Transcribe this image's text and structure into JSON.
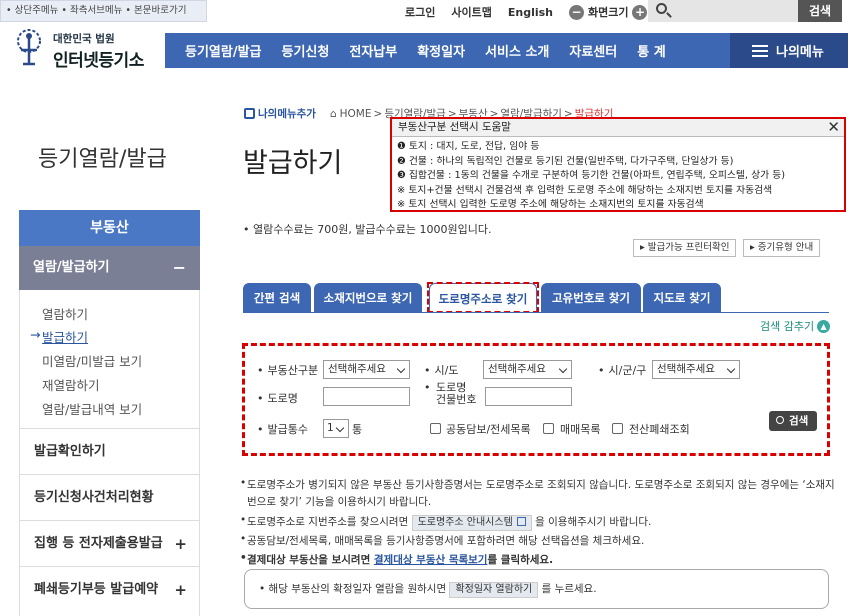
{
  "skip_links": "• 상단주메뉴  • 좌측서브메뉴  • 본문바로가기",
  "util": {
    "login": "로그인",
    "sitemap": "사이트맵",
    "english": "English",
    "screen_size": "화면크기",
    "minus": "−",
    "plus": "+"
  },
  "search": {
    "button": "검색",
    "placeholder": ""
  },
  "logo": {
    "small": "대한민국 법원",
    "big": "인터넷등기소"
  },
  "gnb": [
    "등기열람/발급",
    "등기신청",
    "전자납부",
    "확정일자",
    "서비스 소개",
    "자료센터",
    "통 계"
  ],
  "my_menu": "나의메뉴",
  "sidebar": {
    "title": "등기열람/발급",
    "head": "부동산",
    "active": "열람/발급하기",
    "active_toggle": "−",
    "sub_items": [
      "열람하기",
      "발급하기",
      "미열람/미발급 보기",
      "재열람하기",
      "열람/발급내역 보기"
    ],
    "arrow": "→",
    "items": [
      {
        "label": "발급확인하기",
        "toggle": ""
      },
      {
        "label": "등기신청사건처리현황",
        "toggle": ""
      },
      {
        "label": "집행 등 전자제출용발급",
        "toggle": "+"
      },
      {
        "label": "폐쇄등기부등 발급예약",
        "toggle": "+"
      }
    ]
  },
  "breadcrumb": {
    "my_add": "나의메뉴추가",
    "home": "HOME",
    "sep": ">",
    "parts": [
      "등기열람/발급",
      "부동산",
      "열람/발급하기"
    ],
    "current": "발급하기"
  },
  "page_title": "발급하기",
  "help_popup": {
    "title": "부동산구분 선택시 도움말",
    "close": "✕",
    "lines": [
      "❶ 토지 : 대지, 도로, 전답, 임야 등",
      "❷ 건물 : 하나의 독립적인 건물로 등기된 건물(일반주택, 다가구주택, 단일상가 등)",
      "❸ 집합건물 : 1동의 건물을 수개로 구분하여 등기한 건물(아파트, 연립주택, 오피스텔, 상가 등)",
      "※ 토지+건물 선택시 건물검색 후 입력한 도로명 주소에 해당하는 소재지번 토지를 자동검색",
      "※ 토지 선택시 입력한 도로명 주소에 해당하는 소재지번의 토지를 자동검색"
    ]
  },
  "fee_notice": "• 열람수수료는 700원, 발급수수료는 1000원입니다.",
  "small_buttons": [
    "▸ 발급가능 프린터확인",
    "▸ 증기유형 안내"
  ],
  "tabs": [
    {
      "label": "간편 검색",
      "active": false
    },
    {
      "label": "소재지번으로 찾기",
      "active": false
    },
    {
      "label": "도로명주소로 찾기",
      "active": true
    },
    {
      "label": "고유번호로 찾기",
      "active": false
    },
    {
      "label": "지도로 찾기",
      "active": false
    }
  ],
  "fold_label": "검색 감추기",
  "fold_icon": "▲",
  "form": {
    "row1": [
      {
        "label": "부동산구분",
        "value": "선택해주세요"
      },
      {
        "label": "시/도",
        "value": "선택해주세요"
      },
      {
        "label": "시/군/구",
        "value": "선택해주세요"
      }
    ],
    "road_label": "도로명",
    "bldg_label_1": "도로명",
    "bldg_label_2": "건물번호",
    "count_label": "발급통수",
    "count_value": "1",
    "count_unit": "통",
    "checkboxes": [
      "공동담보/전세목록",
      "매매목록",
      "전산폐쇄조회"
    ],
    "search_button": "검색"
  },
  "notes": {
    "n1a": "도로명주소가 병기되지 않은 부동산 등기사항증명서는 도로명주소로 조회되지 않습니다. 도로명주소로 조회되지 않는 경우에는 ‘소재지",
    "n1b": "번으로 찾기’ 기능을 이용하시기 바랍니다.",
    "n2_pre": "도로명주소로 지번주소를 찾으시려면",
    "n2_pill": "도로명주소 안내시스템",
    "n2_post": "을 이용해주시기 바랍니다.",
    "n3": "공동담보/전세목록, 매매목록을 등기사항증명서에 포함하려면 해당 선택옵션을 체크하세요.",
    "n4_pre": "결제대상 부동산을 보시려면",
    "n4_link": "결제대상 부동산 목록보기",
    "n4_post": "를 클릭하세요.",
    "box_pre": "• 해당 부동산의 확정일자 열람을 원하시면",
    "box_pill": "확정일자 열람하기",
    "box_post": "를 누르세요."
  }
}
